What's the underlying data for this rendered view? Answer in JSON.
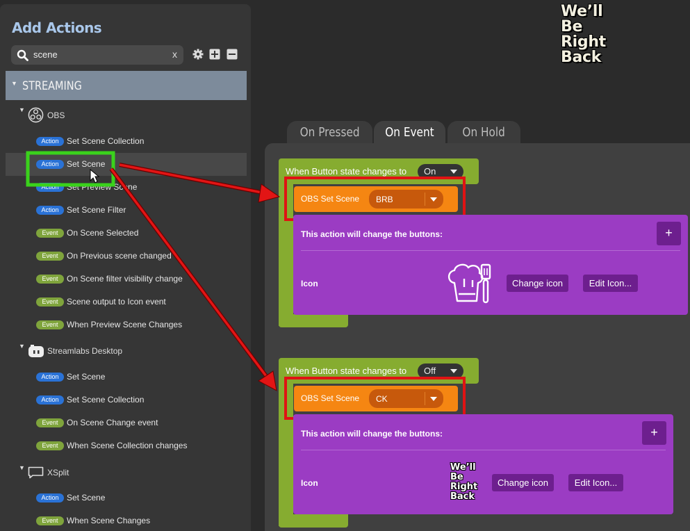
{
  "panel": {
    "title": "Add Actions",
    "search_value": "scene",
    "clear_label": "x",
    "category": "STREAMING"
  },
  "groups": {
    "obs": {
      "name": "OBS",
      "items": [
        {
          "type": "Action",
          "label": "Set Scene Collection"
        },
        {
          "type": "Action",
          "label": "Set Scene"
        },
        {
          "type": "Action",
          "label": "Set Preview Scene"
        },
        {
          "type": "Action",
          "label": "Set Scene Filter"
        },
        {
          "type": "Event",
          "label": "On Scene Selected"
        },
        {
          "type": "Event",
          "label": "On Previous scene changed"
        },
        {
          "type": "Event",
          "label": "On Scene filter visibility change"
        },
        {
          "type": "Event",
          "label": "Scene output to Icon event"
        },
        {
          "type": "Event",
          "label": "When Preview Scene Changes"
        }
      ]
    },
    "streamlabs": {
      "name": "Streamlabs Desktop",
      "items": [
        {
          "type": "Action",
          "label": "Set Scene"
        },
        {
          "type": "Action",
          "label": "Set Scene Collection"
        },
        {
          "type": "Event",
          "label": "On Scene Change event"
        },
        {
          "type": "Event",
          "label": "When Scene Collection changes"
        }
      ]
    },
    "xsplit": {
      "name": "XSplit",
      "items": [
        {
          "type": "Action",
          "label": "Set Scene"
        },
        {
          "type": "Event",
          "label": "When Scene Changes"
        }
      ]
    }
  },
  "preview": {
    "line1": "We’ll",
    "line2": "Be",
    "line3": "Right",
    "line4": "Back"
  },
  "tabs": [
    "On Pressed",
    "On Event",
    "On Hold"
  ],
  "active_tab": "On Event",
  "blocks": [
    {
      "condition": "When Button state changes to",
      "state": "On",
      "action": "OBS Set Scene",
      "scene": "BRB",
      "change_text": "This action will change the buttons:",
      "plus": "+",
      "icon_label": "Icon",
      "change_icon": "Change icon",
      "edit_icon": "Edit Icon..."
    },
    {
      "condition": "When Button state changes to",
      "state": "Off",
      "action": "OBS Set Scene",
      "scene": "CK",
      "change_text": "This action will change the buttons:",
      "plus": "+",
      "icon_label": "Icon",
      "change_icon": "Change icon",
      "edit_icon": "Edit Icon..."
    }
  ],
  "colors": {
    "action_pill": "#2a72d6",
    "event_pill": "#7fa43c",
    "condition_block": "#86ac30",
    "action_block": "#f58612",
    "change_block": "#9b3cc3",
    "highlight_green": "#3ad21c",
    "highlight_red": "#e01313"
  }
}
